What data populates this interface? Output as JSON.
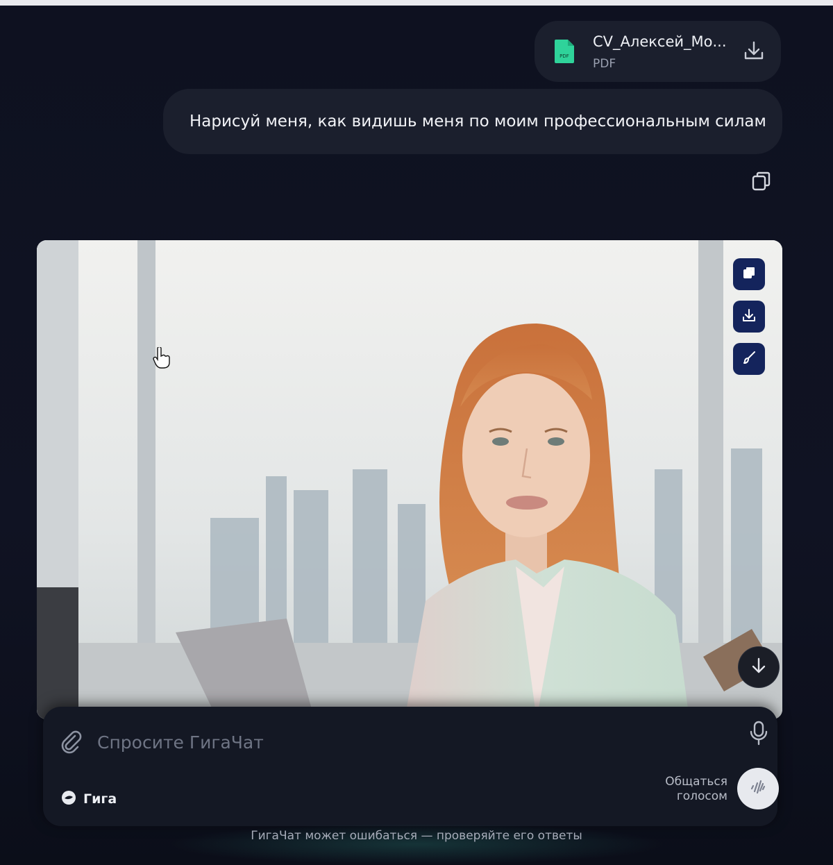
{
  "attachment": {
    "file_name": "CV_Алексей_Мо...",
    "file_type": "PDF",
    "icon": "pdf-file-icon",
    "badge": "PDF"
  },
  "user_message": {
    "text": "Нарисуй меня, как видишь меня по моим профессиональным силам"
  },
  "generated_image": {
    "description_icon": "generated-image",
    "actions": [
      "copy-icon",
      "download-icon",
      "edit-brush-icon"
    ]
  },
  "composer": {
    "placeholder": "Спросите ГигаЧат",
    "model_label": "Гига",
    "voice_label_line1": "Общаться",
    "voice_label_line2": "голосом"
  },
  "footer": {
    "disclaimer": "ГигаЧат может ошибаться — проверяйте его ответы"
  },
  "colors": {
    "background": "#0e1120",
    "bubble": "#1b1f2d",
    "action_button": "#14245c",
    "pdf_green": "#2fd39a"
  }
}
